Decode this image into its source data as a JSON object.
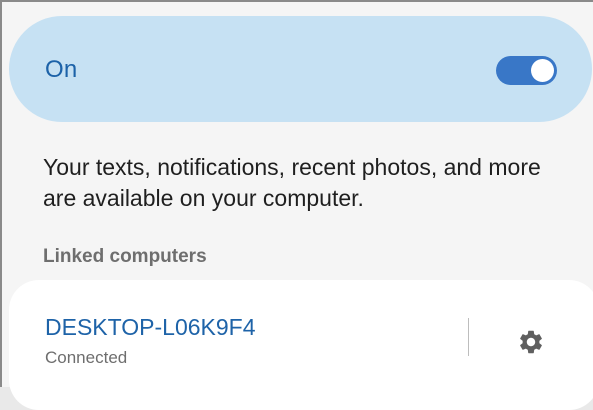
{
  "toggle": {
    "label": "On",
    "state": "on",
    "accent_color": "#3977c7"
  },
  "description": "Your texts, notifications, recent photos, and more are available on your computer.",
  "linked_computers": {
    "header": "Linked computers",
    "items": [
      {
        "name": "DESKTOP-L06K9F4",
        "status": "Connected",
        "icon": "gear-icon"
      }
    ]
  }
}
